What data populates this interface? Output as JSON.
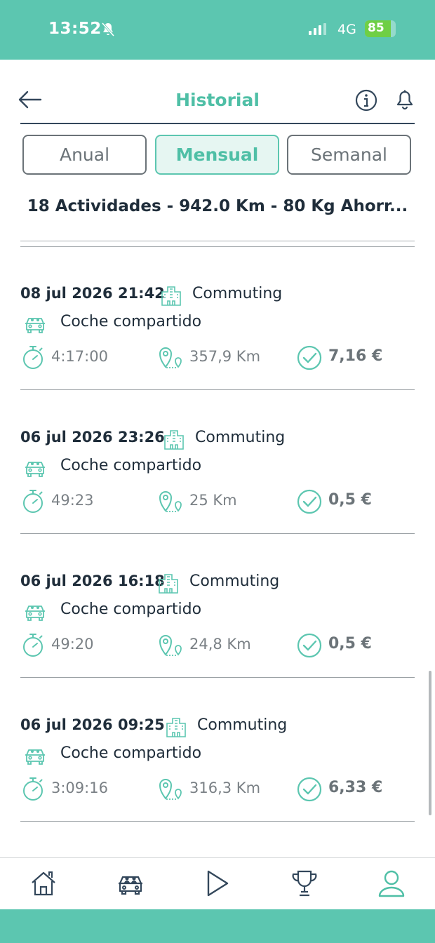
{
  "status_bar": {
    "time": "13:52",
    "network": "4G",
    "battery": "85",
    "battery_level": 0.85
  },
  "header": {
    "title": "Historial"
  },
  "tabs": [
    {
      "label": "Anual",
      "active": false
    },
    {
      "label": "Mensual",
      "active": true
    },
    {
      "label": "Semanal",
      "active": false
    }
  ],
  "summary": "18 Actividades - 942.0 Km - 80 Kg Ahorr...",
  "activities": [
    {
      "date": "08 jul 2026 21:42",
      "category": "Commuting",
      "mode": "Coche compartido",
      "duration": "4:17:00",
      "distance": "357,9 Km",
      "amount": "7,16 €"
    },
    {
      "date": "06 jul 2026 23:26",
      "category": "Commuting",
      "mode": "Coche compartido",
      "duration": "49:23",
      "distance": "25 Km",
      "amount": "0,5 €"
    },
    {
      "date": "06 jul 2026 16:18",
      "category": "Commuting",
      "mode": "Coche compartido",
      "duration": "49:20",
      "distance": "24,8 Km",
      "amount": "0,5 €"
    },
    {
      "date": "06 jul 2026 09:25",
      "category": "Commuting",
      "mode": "Coche compartido",
      "duration": "3:09:16",
      "distance": "316,3 Km",
      "amount": "6,33 €"
    }
  ],
  "nav": {
    "items": [
      "home-icon",
      "car-icon",
      "play-icon",
      "trophy-icon",
      "profile-icon"
    ],
    "active": "profile-icon"
  },
  "colors": {
    "accent": "#5cc6b0",
    "accent_text": "#4fbfa6",
    "text_dark": "#1f2d3a",
    "text_muted": "#7a8085"
  }
}
